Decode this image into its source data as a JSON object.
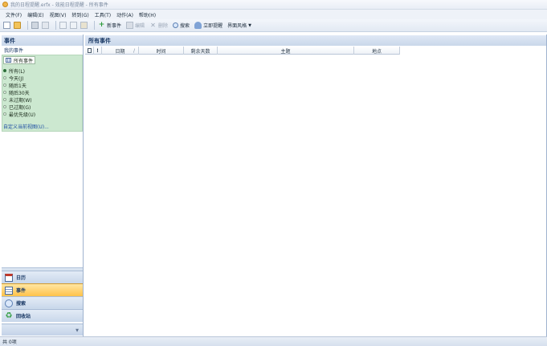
{
  "window": {
    "title": "我的日程提醒.erfx - 效能日程提醒 - 所有事件"
  },
  "menu": [
    "文件(F)",
    "编辑(E)",
    "视图(V)",
    "转到(G)",
    "工具(T)",
    "动作(A)",
    "帮助(H)"
  ],
  "toolbar": {
    "new_event": "新事件",
    "edit": "编辑",
    "delete": "删除",
    "search": "搜索",
    "remind_now": "立即提醒",
    "theme": "界面风格"
  },
  "left_pane": {
    "header": "事件",
    "my_events": "我的事件",
    "all_events_button": "所有事件",
    "filters": [
      "所有(L)",
      "今天(J)",
      "随后1天",
      "随后30天",
      "未过期(W)",
      "已过期(G)",
      "最优先级(U)"
    ],
    "selected_filter": 0,
    "custom_view": "自定义当前视图(U)..."
  },
  "nav": {
    "calendar": "日历",
    "events": "事件",
    "search": "搜索",
    "recycle_bin": "回收站"
  },
  "main": {
    "header": "所有事件",
    "columns": [
      "",
      "",
      "日期",
      "时间",
      "剩余天数",
      "主题",
      "地点"
    ]
  },
  "status": {
    "text": "共 0项"
  },
  "colors": {
    "accent": "#ffc24a",
    "panel_green": "#cce8d0",
    "header_blue": "#c9d7ea",
    "title_text": "#1b3a66"
  }
}
